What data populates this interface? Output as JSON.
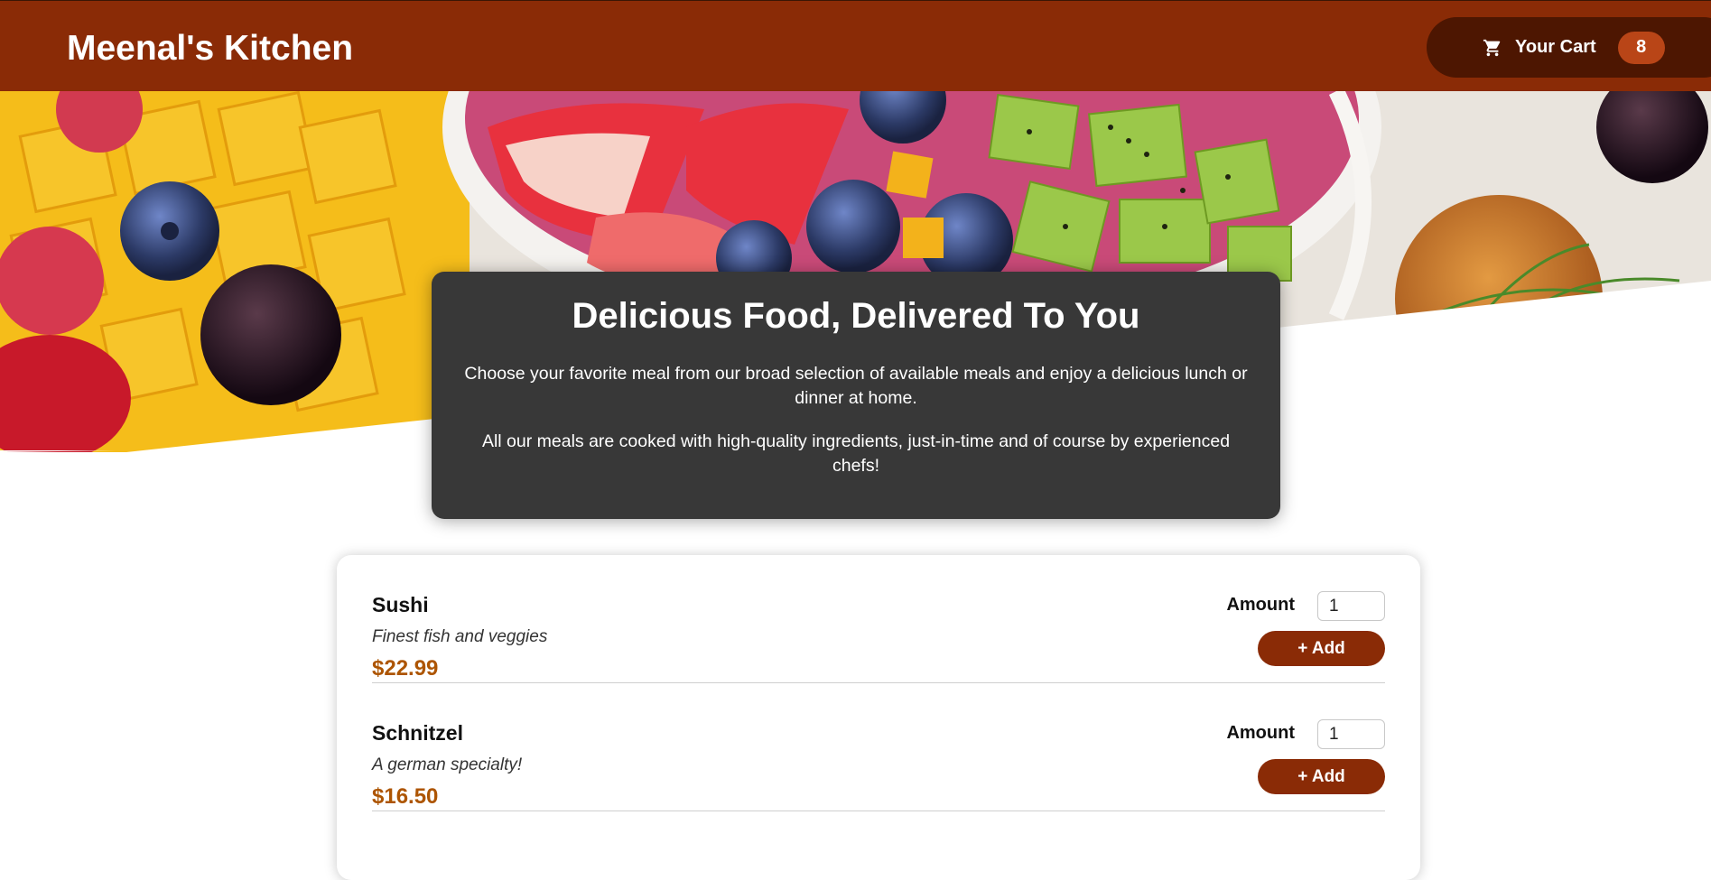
{
  "header": {
    "brand": "Meenal's Kitchen",
    "cart_label": "Your Cart",
    "cart_count": "8",
    "cart_icon": "shopping-cart-icon"
  },
  "summary": {
    "title": "Delicious Food, Delivered To You",
    "paragraph1": "Choose your favorite meal from our broad selection of available meals and enjoy a delicious lunch or dinner at home.",
    "paragraph2": "All our meals are cooked with high-quality ingredients, just-in-time and of course by experienced chefs!"
  },
  "meals": [
    {
      "name": "Sushi",
      "description": "Finest fish and veggies",
      "price": "$22.99",
      "amount_label": "Amount",
      "amount_value": "1",
      "add_label": "+ Add"
    },
    {
      "name": "Schnitzel",
      "description": "A german specialty!",
      "price": "$16.50",
      "amount_label": "Amount",
      "amount_value": "1",
      "add_label": "+ Add"
    }
  ],
  "colors": {
    "header": "#8a2b06",
    "cart_button": "#4d1601",
    "badge": "#b94517",
    "price": "#ad5502",
    "summary_bg": "#383838"
  }
}
